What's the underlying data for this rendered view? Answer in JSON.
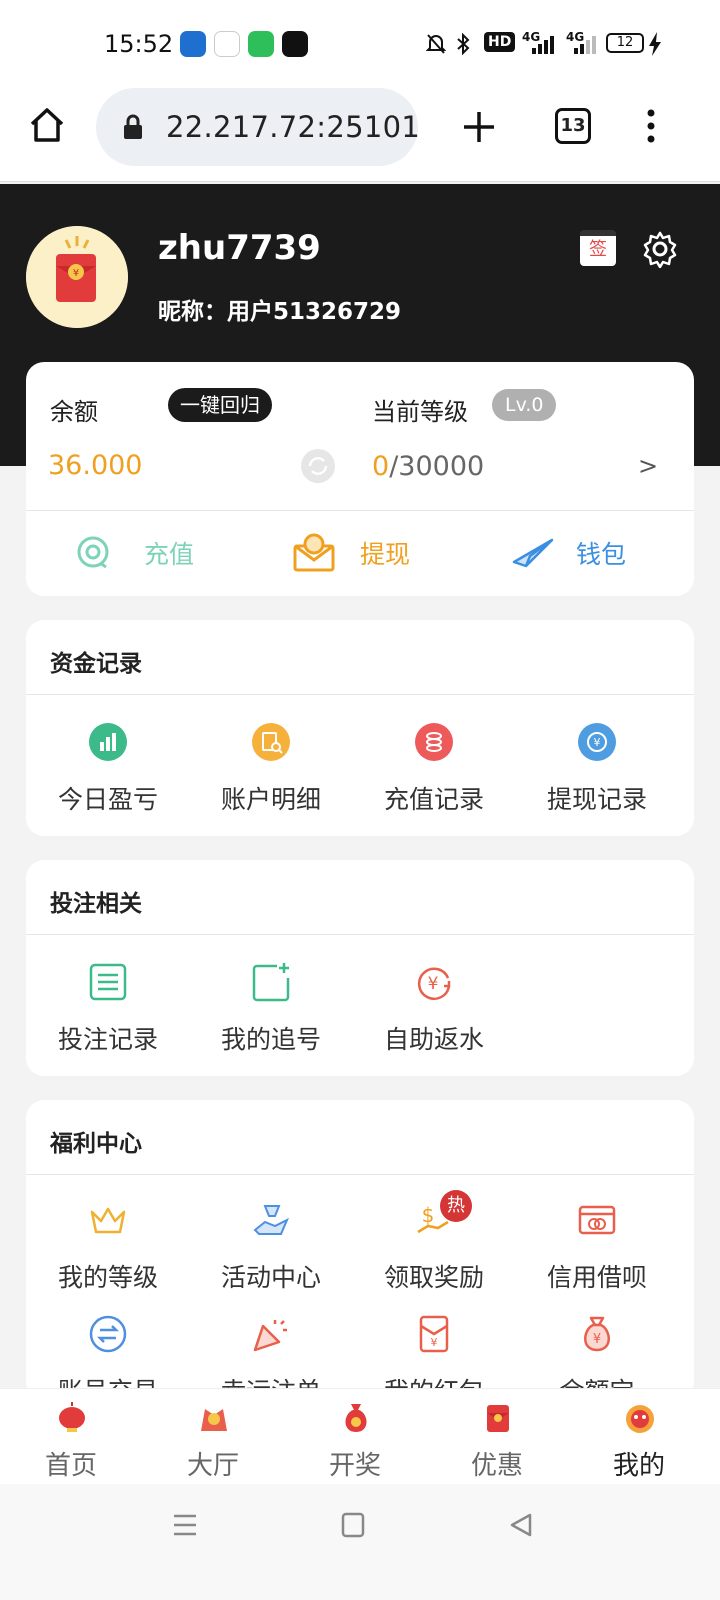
{
  "status_bar": {
    "time": "15:52",
    "battery": "12",
    "network": "4G",
    "network2": "4G"
  },
  "browser": {
    "url": "22.217.72:25101",
    "tab_count": "13"
  },
  "profile": {
    "username": "zhu7739",
    "nickname": "昵称：用户51326729",
    "sign_label": "签"
  },
  "balance": {
    "label": "余额",
    "recall_button": "一键回归",
    "value": "36.000",
    "level_label": "当前等级",
    "level_badge": "Lv.0",
    "level_progress_current": "0",
    "level_progress_total": "/30000",
    "arrow": ">"
  },
  "actions": [
    {
      "label": "充值",
      "icon": "recharge-icon",
      "color": "#7dd3b8"
    },
    {
      "label": "提现",
      "icon": "withdraw-icon",
      "color": "#f0a020"
    },
    {
      "label": "钱包",
      "icon": "wallet-icon",
      "color": "#3b8fe0"
    }
  ],
  "fund_records": {
    "title": "资金记录",
    "items": [
      {
        "label": "今日盈亏",
        "icon": "bar-chart-icon",
        "color": "#3cba8a"
      },
      {
        "label": "账户明细",
        "icon": "search-document-icon",
        "color": "#f6b13c"
      },
      {
        "label": "充值记录",
        "icon": "coins-icon",
        "color": "#ee5a5a"
      },
      {
        "label": "提现记录",
        "icon": "yuan-refresh-icon",
        "color": "#4d9de0"
      }
    ]
  },
  "betting": {
    "title": "投注相关",
    "items": [
      {
        "label": "投注记录",
        "icon": "list-icon",
        "color": "#3cba8a"
      },
      {
        "label": "我的追号",
        "icon": "add-square-icon",
        "color": "#3cba8a"
      },
      {
        "label": "自助返水",
        "icon": "yuan-cycle-icon",
        "color": "#e8604c"
      }
    ]
  },
  "welfare": {
    "title": "福利中心",
    "items": [
      {
        "label": "我的等级",
        "icon": "crown-icon",
        "color": "#f0b030"
      },
      {
        "label": "活动中心",
        "icon": "gift-hand-icon",
        "color": "#4d8fe0"
      },
      {
        "label": "领取奖励",
        "icon": "money-hand-icon",
        "color": "#f0a020",
        "badge": "热"
      },
      {
        "label": "信用借呗",
        "icon": "card-icon",
        "color": "#e8604c"
      },
      {
        "label": "账号交易",
        "icon": "exchange-icon",
        "color": "#4d8fe0"
      },
      {
        "label": "幸运注单",
        "icon": "party-popper-icon",
        "color": "#e8604c"
      },
      {
        "label": "我的红包",
        "icon": "red-envelope-icon",
        "color": "#e8604c"
      },
      {
        "label": "余额宝",
        "icon": "money-bag-icon",
        "color": "#e8604c"
      }
    ]
  },
  "bottom_nav": [
    {
      "label": "首页",
      "icon": "lantern-icon"
    },
    {
      "label": "大厅",
      "icon": "lion-dance-icon"
    },
    {
      "label": "开奖",
      "icon": "lucky-bag-icon"
    },
    {
      "label": "优惠",
      "icon": "red-packet-icon"
    },
    {
      "label": "我的",
      "icon": "lion-head-icon",
      "active": true
    }
  ]
}
